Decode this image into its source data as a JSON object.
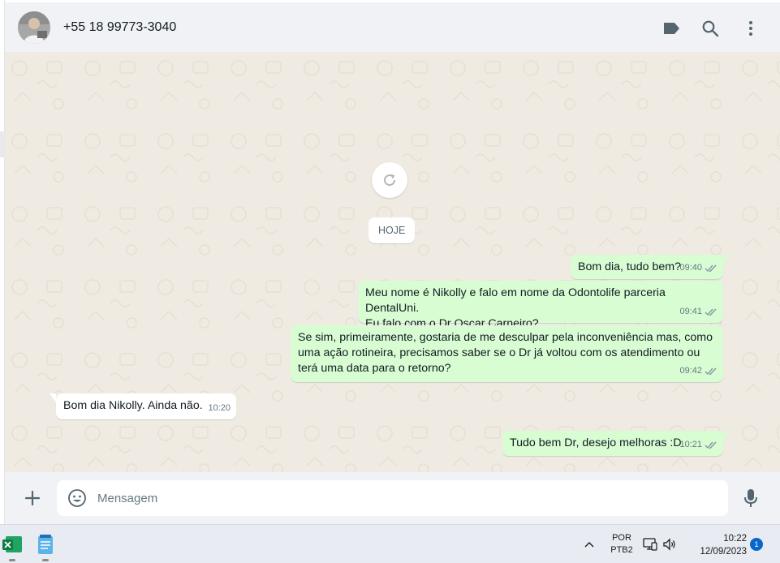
{
  "header": {
    "contact_name": "+55 18 99773-3040"
  },
  "chat": {
    "date_divider": "HOJE",
    "messages": [
      {
        "direction": "out",
        "text": "Bom dia, tudo bem?",
        "time": "09:40",
        "status": "delivered"
      },
      {
        "direction": "out",
        "text": "Meu nome é Nikolly e falo em nome da Odontolife parceria DentalUni.\nEu falo com o Dr Oscar Carneiro?",
        "time": "09:41",
        "status": "delivered"
      },
      {
        "direction": "out",
        "text": "Se sim, primeiramente, gostaria de me desculpar pela inconveniência mas, como\numa ação rotineira, precisamos saber se o Dr já voltou com os atendimento ou\nterá uma data para o retorno?",
        "time": "09:42",
        "status": "delivered"
      },
      {
        "direction": "in",
        "text": "Bom dia Nikolly. Ainda não.",
        "time": "10:20"
      },
      {
        "direction": "out",
        "text": "Tudo bem Dr, desejo melhoras :D",
        "time": "10:21",
        "status": "delivered"
      }
    ]
  },
  "composer": {
    "placeholder": "Mensagem"
  },
  "taskbar": {
    "lang_line1": "POR",
    "lang_line2": "PTB2",
    "time": "10:22",
    "date": "12/09/2023",
    "notification_count": "1"
  },
  "colors": {
    "outgoing_bubble": "#d9fdd3",
    "incoming_bubble": "#ffffff",
    "chat_background": "#efeae2",
    "header_background": "#f0f2f5"
  }
}
